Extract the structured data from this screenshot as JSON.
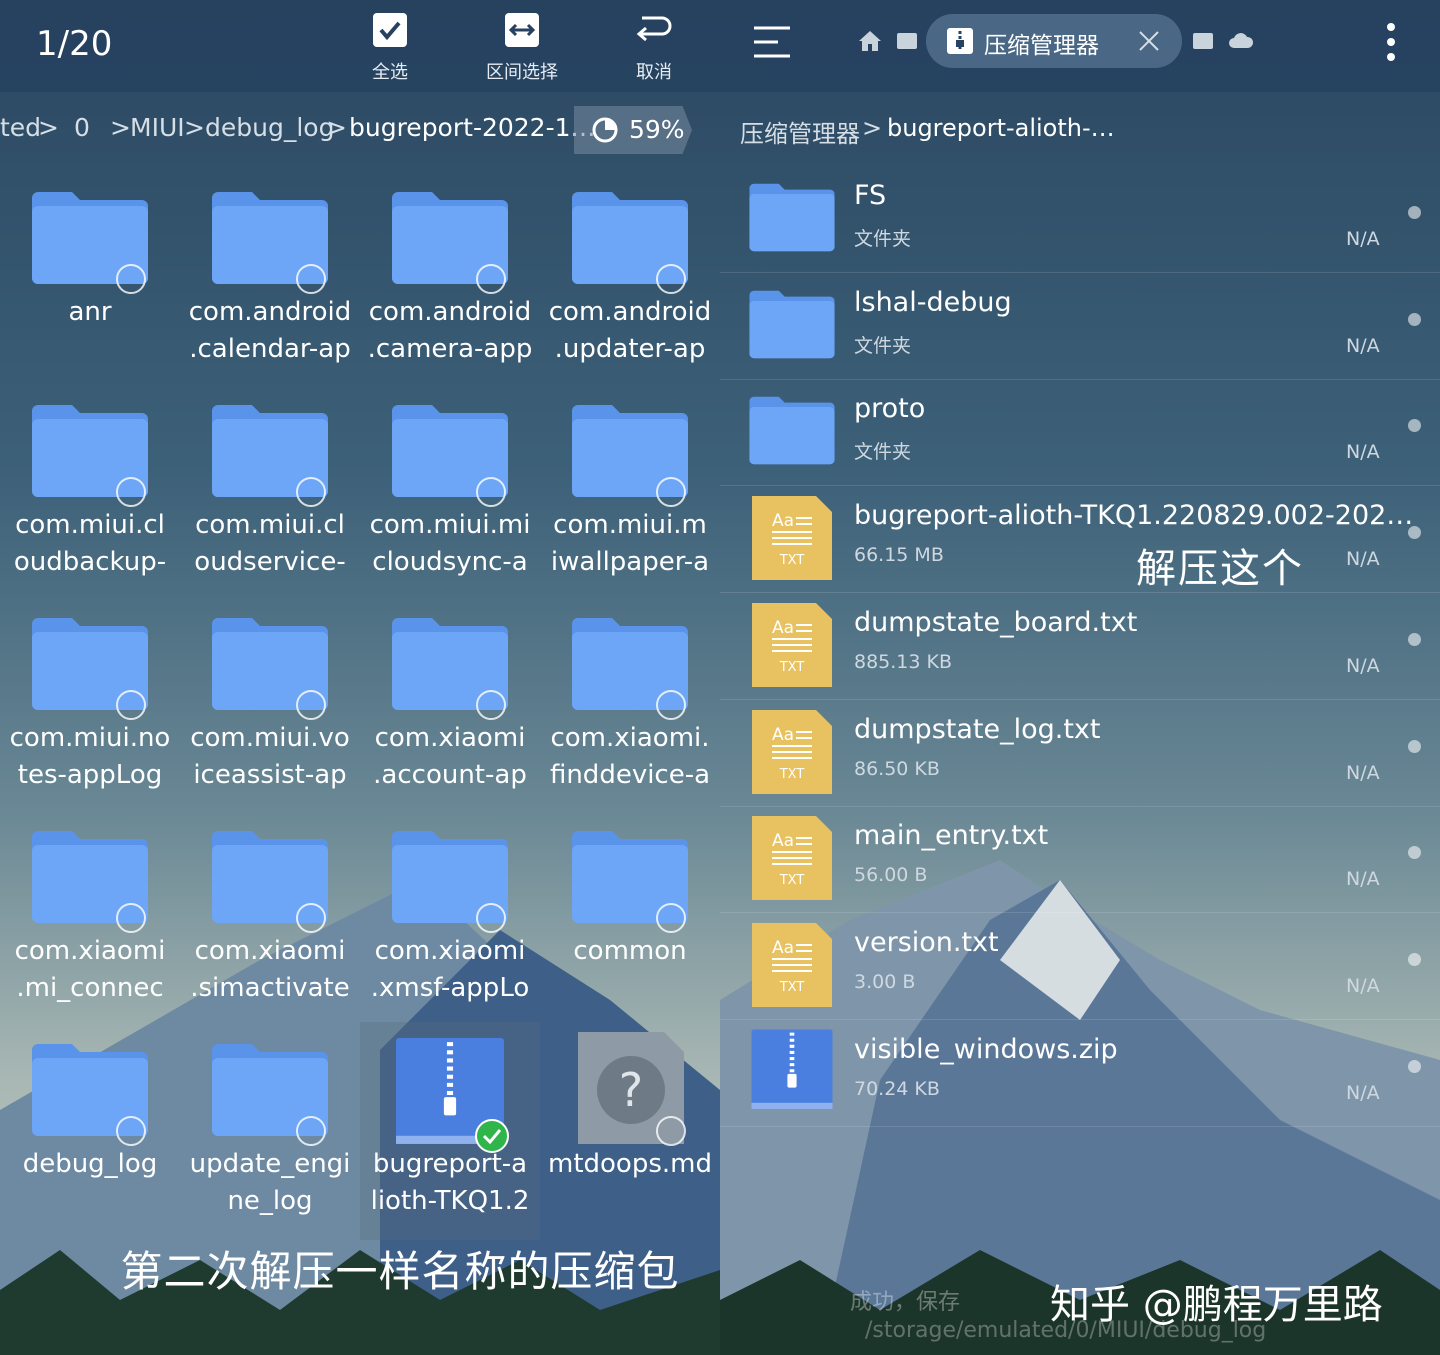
{
  "left": {
    "counter": "1/20",
    "toolbar": [
      {
        "label": "全选",
        "icon": "check-square-icon"
      },
      {
        "label": "区间选择",
        "icon": "range-select-icon"
      },
      {
        "label": "取消",
        "icon": "undo-arrow-icon"
      }
    ],
    "breadcrumb": [
      "ted",
      "0",
      "MIUI",
      "debug_log",
      "bugreport-2022-1…"
    ],
    "storage_percent": "59%",
    "items": [
      {
        "name": "anr",
        "type": "folder"
      },
      {
        "name": "com.android\n.calendar-ap",
        "type": "folder"
      },
      {
        "name": "com.android\n.camera-app",
        "type": "folder"
      },
      {
        "name": "com.android\n.updater-ap",
        "type": "folder"
      },
      {
        "name": "com.miui.cl\noudbackup-",
        "type": "folder"
      },
      {
        "name": "com.miui.cl\noudservice-",
        "type": "folder"
      },
      {
        "name": "com.miui.mi\ncloudsync-a",
        "type": "folder"
      },
      {
        "name": "com.miui.m\niwallpaper-a",
        "type": "folder"
      },
      {
        "name": "com.miui.no\ntes-appLog",
        "type": "folder"
      },
      {
        "name": "com.miui.vo\niceassist-ap",
        "type": "folder"
      },
      {
        "name": "com.xiaomi\n.account-ap",
        "type": "folder"
      },
      {
        "name": "com.xiaomi.\nfinddevice-a",
        "type": "folder"
      },
      {
        "name": "com.xiaomi\n.mi_connec",
        "type": "folder"
      },
      {
        "name": "com.xiaomi\n.simactivate",
        "type": "folder"
      },
      {
        "name": "com.xiaomi\n.xmsf-appLo",
        "type": "folder"
      },
      {
        "name": "common",
        "type": "folder"
      },
      {
        "name": "debug_log",
        "type": "folder"
      },
      {
        "name": "update_engi\nne_log",
        "type": "folder"
      },
      {
        "name": "bugreport-a\nlioth-TKQ1.2",
        "type": "zip",
        "selected": true
      },
      {
        "name": "mtdoops.md",
        "type": "unknown"
      }
    ],
    "caption": "第二次解压一样名称的压缩包"
  },
  "right": {
    "tab_title": "压缩管理器",
    "breadcrumb": [
      "压缩管理器",
      "bugreport-alioth-…"
    ],
    "files": [
      {
        "name": "FS",
        "meta": "文件夹",
        "date": "N/A",
        "type": "folder"
      },
      {
        "name": "lshal-debug",
        "meta": "文件夹",
        "date": "N/A",
        "type": "folder"
      },
      {
        "name": "proto",
        "meta": "文件夹",
        "date": "N/A",
        "type": "folder"
      },
      {
        "name": "bugreport-alioth-TKQ1.220829.002-202…",
        "meta": "66.15 MB",
        "date": "N/A",
        "type": "txt"
      },
      {
        "name": "dumpstate_board.txt",
        "meta": "885.13 KB",
        "date": "N/A",
        "type": "txt"
      },
      {
        "name": "dumpstate_log.txt",
        "meta": "86.50 KB",
        "date": "N/A",
        "type": "txt"
      },
      {
        "name": "main_entry.txt",
        "meta": "56.00 B",
        "date": "N/A",
        "type": "txt"
      },
      {
        "name": "version.txt",
        "meta": "3.00 B",
        "date": "N/A",
        "type": "txt"
      },
      {
        "name": "visible_windows.zip",
        "meta": "70.24 KB",
        "date": "N/A",
        "type": "zip"
      }
    ],
    "txt_icon": {
      "top": "Aa",
      "bottom": "TXT"
    },
    "annotation": "解压这个",
    "toast_line1": "成功，保存",
    "toast_line2": "/storage/emulated/0/MIUI/debug_log",
    "watermark": "知乎 @鹏程万里路"
  },
  "colors": {
    "folder": "#6ea6f7",
    "folder_tab": "#5a93ea",
    "txt": "#e8c160",
    "zip": "#4a7fe0",
    "topbar": "#264260"
  }
}
